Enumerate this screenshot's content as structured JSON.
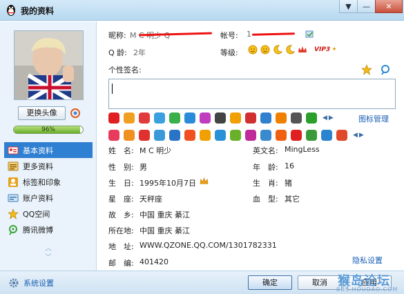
{
  "window": {
    "title": "我的资料",
    "controls": [
      "▼",
      "—",
      "✕"
    ]
  },
  "left": {
    "change_avatar": "更换头像",
    "completion": "96%",
    "completion_value": 0.96,
    "nav": [
      {
        "label": "基本资料",
        "icon": "card-icon",
        "active": true
      },
      {
        "label": "更多资料",
        "icon": "list-icon",
        "active": false
      },
      {
        "label": "标签和印象",
        "icon": "tag-icon",
        "active": false
      },
      {
        "label": "账户资料",
        "icon": "account-icon",
        "active": false
      },
      {
        "label": "QQ空间",
        "icon": "star-icon",
        "active": false
      },
      {
        "label": "腾讯微博",
        "icon": "weibo-icon",
        "active": false
      }
    ],
    "scroll_up": "︿",
    "scroll_down": "﹀"
  },
  "header": {
    "nickname_label": "昵称:",
    "nickname_value": "M C 明少 Q",
    "account_label": "帐号:",
    "account_value": "1",
    "qage_label": "Q 龄:",
    "qage_value": "2年",
    "level_label": "等级:",
    "vip": "VIP3",
    "signature_label": "个性签名:"
  },
  "badges": {
    "manage_link": "图标管理",
    "row1": [
      "#e02020",
      "#f0a020",
      "#e23b3b",
      "#3aa0e0",
      "#3ab04a",
      "#2a8cd8",
      "#c03cc0",
      "#444444",
      "#f0a000",
      "#d03030",
      "#3080d0",
      "#f08000",
      "#555555",
      "#2aa02a"
    ],
    "row2": [
      "#e83a5a",
      "#f09020",
      "#e03030",
      "#3a9ad8",
      "#2a74c8",
      "#f05020",
      "#f0a000",
      "#2a90d8",
      "#6ab02a",
      "#c02a9a",
      "#3a8ad0",
      "#f06010",
      "#e02020",
      "#3a9a3a",
      "#2a84d0",
      "#e04a2a"
    ]
  },
  "fields": {
    "name_label": "姓　名:",
    "name_value": "M C 明少",
    "en_name_label": "英文名:",
    "en_name_value": "MingLess",
    "gender_label": "性　别:",
    "gender_value": "男",
    "age_label": "年　龄:",
    "age_value": "16",
    "birthday_label": "生　日:",
    "birthday_value": "1995年10月7日",
    "zodiac_label": "生　肖:",
    "zodiac_value": "猪",
    "constellation_label": "星　座:",
    "constellation_value": "天秤座",
    "blood_label": "血　型:",
    "blood_value": "其它",
    "hometown_label": "故　乡:",
    "hometown_value": "中国  重庆  綦江",
    "location_label": "所在地:",
    "location_value": "中国  重庆  綦江",
    "address_label": "地　址:",
    "address_value": "WWW.QZONE.QQ.COM/1301782331",
    "postcode_label": "邮　编:",
    "postcode_value": "401420",
    "privacy_link": "隐私设置"
  },
  "footer": {
    "settings": "系统设置",
    "ok": "确定",
    "cancel": "取消",
    "apply": "应用"
  },
  "watermark": {
    "main": "猴岛论坛",
    "sub": "BBS.HOUDAO.COM"
  }
}
